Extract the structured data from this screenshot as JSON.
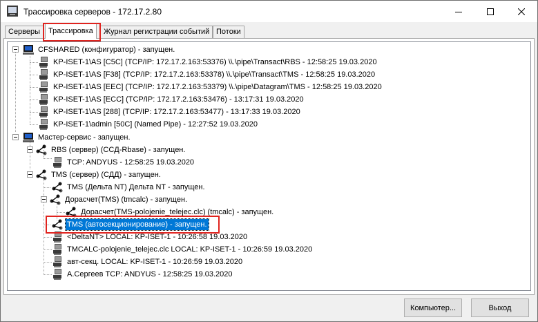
{
  "window": {
    "title": "Трассировка серверов - 172.17.2.80"
  },
  "tabs": [
    {
      "label": "Серверы"
    },
    {
      "label": "Трассировка"
    },
    {
      "label": "Журнал регистрации событий"
    },
    {
      "label": "Потоки"
    }
  ],
  "tree": {
    "nodes": [
      {
        "text": "CFSHARED (конфигуратор)  - запущен."
      },
      {
        "text": "KP-ISET-1\\AS [C5C] (TCP/IP: 172.17.2.163:53376)  \\\\.\\pipe\\Transact\\RBS  - 12:58:25  19.03.2020"
      },
      {
        "text": "KP-ISET-1\\AS [F38] (TCP/IP: 172.17.2.163:53378)  \\\\.\\pipe\\Transact\\TMS  - 12:58:25  19.03.2020"
      },
      {
        "text": "KP-ISET-1\\AS [EEC] (TCP/IP: 172.17.2.163:53379)  \\\\.\\pipe\\Datagram\\TMS  - 12:58:25  19.03.2020"
      },
      {
        "text": "KP-ISET-1\\AS [ECC] (TCP/IP: 172.17.2.163:53476)    - 13:17:31  19.03.2020"
      },
      {
        "text": "KP-ISET-1\\AS [288] (TCP/IP: 172.17.2.163:53477)    - 13:17:33  19.03.2020"
      },
      {
        "text": "KP-ISET-1\\admin [50C] (Named Pipe)    - 12:27:52  19.03.2020"
      },
      {
        "text": "Мастер-сервис  - запущен."
      },
      {
        "text": "RBS (сервер) (СCД-Rbase)  - запущен."
      },
      {
        "text": "TCP: ANDYUS  - 12:58:25  19.03.2020"
      },
      {
        "text": "TMS (сервер) (СДД)  - запущен."
      },
      {
        "text": "TMS (Дельта NT) Дельта NT  - запущен."
      },
      {
        "text": "Дорасчет(TMS) (tmcalc)  - запущен."
      },
      {
        "text": "Дорасчет(TMS-polojenie_telejec.clc) (tmcalc)  - запущен."
      },
      {
        "text": "TMS (автосекционирование)  - запущен."
      },
      {
        "text": "<DeltaNT> LOCAL: KP-ISET-1 - 10:26:58  19.03.2020"
      },
      {
        "text": "TMCALC-polojenie_telejec.clc LOCAL: KP-ISET-1 - 10:26:59  19.03.2020"
      },
      {
        "text": "авт-секц. LOCAL: KP-ISET-1 - 10:26:59  19.03.2020"
      },
      {
        "text": "А.Сергеев TCP: ANDYUS  - 12:58:25  19.03.2020"
      }
    ]
  },
  "buttons": {
    "computer": "Компьютер...",
    "exit": "Выход"
  },
  "colors": {
    "selection": "#0078d7",
    "highlight_box": "#e0231e"
  }
}
